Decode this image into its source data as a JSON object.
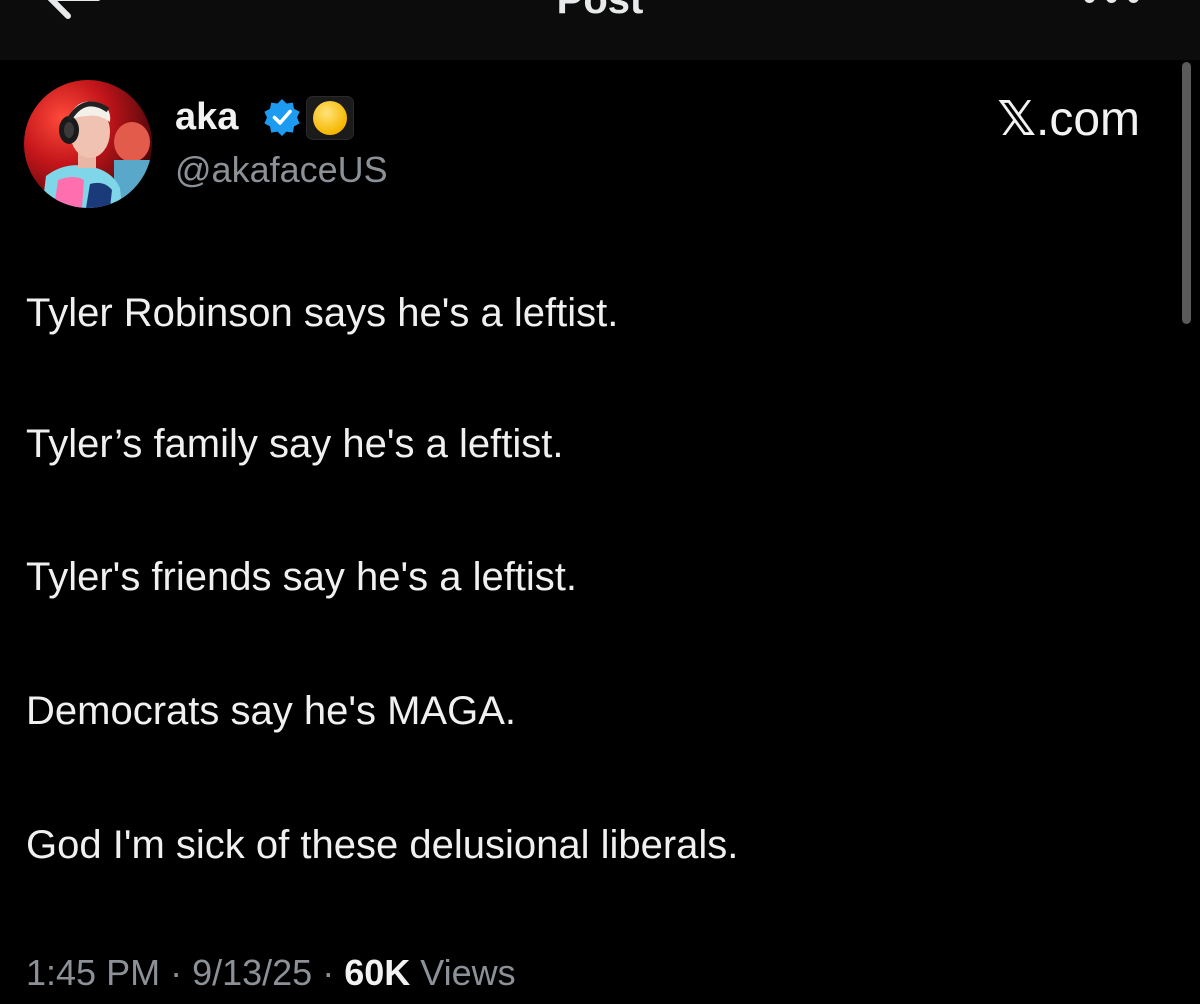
{
  "header": {
    "title": "Post",
    "back_icon": "arrow-left-icon",
    "more_icon": "more-horizontal-icon"
  },
  "post": {
    "author": {
      "display_name": "aka",
      "handle": "@akafaceUS",
      "verified_icon": "verified-badge-icon",
      "affiliate_icon": "gold-coin-icon"
    },
    "brand": {
      "x_glyph": "𝕏",
      "suffix": ".com"
    },
    "lines": [
      "Tyler Robinson says he's a leftist.",
      "Tyler’s family say he's a leftist.",
      "Tyler's friends say he's a leftist.",
      "Democrats say he's MAGA.",
      "God I'm sick of these delusional liberals."
    ],
    "meta": {
      "time": "1:45 PM",
      "separator1": " · ",
      "date": "9/13/25",
      "separator2": " · ",
      "views_count": "60K",
      "views_label": " Views"
    }
  },
  "colors": {
    "background": "#000000",
    "topbar": "#0c0c0c",
    "text_primary": "#e7e9ea",
    "text_secondary": "#8b9196",
    "verified_blue": "#1d9bf0"
  }
}
